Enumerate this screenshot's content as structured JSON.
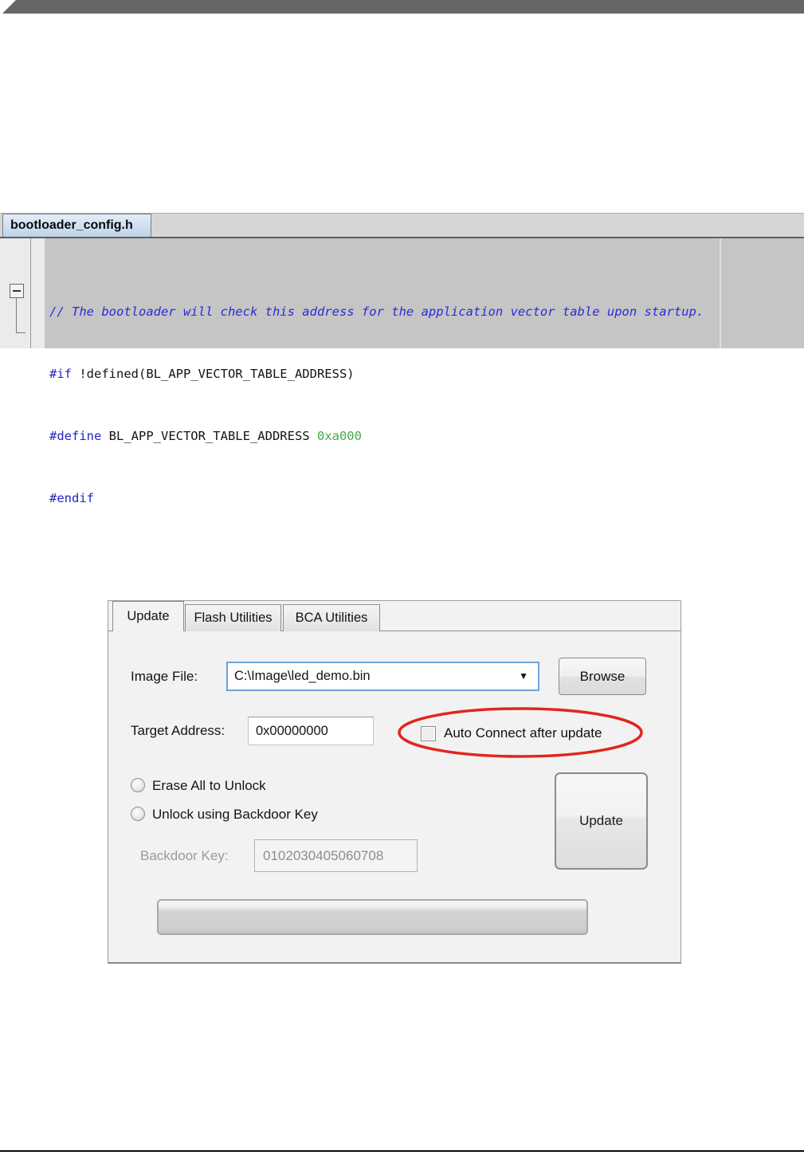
{
  "page": {
    "top_banner_color": "#666666",
    "bottom_rule_color": "#0a0a0a"
  },
  "code_editor": {
    "tab_label": "bootloader_config.h",
    "colors": {
      "background": "#c5c5c5",
      "comment": "#2a2ad8",
      "directive": "#2323c8",
      "plain": "#141414",
      "number": "#44aa44"
    },
    "lines": [
      {
        "tokens": [
          {
            "type": "comment",
            "text": "// The bootloader will check this address for the application vector table upon startup."
          }
        ]
      },
      {
        "tokens": [
          {
            "type": "directive",
            "text": "#if"
          },
          {
            "type": "plain",
            "text": " !defined(BL_APP_VECTOR_TABLE_ADDRESS)"
          }
        ]
      },
      {
        "tokens": [
          {
            "type": "directive",
            "text": "#define"
          },
          {
            "type": "plain",
            "text": " BL_APP_VECTOR_TABLE_ADDRESS "
          },
          {
            "type": "number",
            "text": "0xa000"
          }
        ]
      },
      {
        "tokens": [
          {
            "type": "directive",
            "text": "#endif"
          }
        ]
      }
    ]
  },
  "dialog": {
    "tabs": [
      {
        "label": "Update",
        "active": true
      },
      {
        "label": "Flash Utilities",
        "active": false
      },
      {
        "label": "BCA Utilities",
        "active": false
      }
    ],
    "image_file": {
      "label": "Image File:",
      "value": "C:\\Image\\led_demo.bin",
      "dropdown_icon": "▼",
      "browse_label": "Browse"
    },
    "target_address": {
      "label": "Target Address:",
      "value": "0x00000000"
    },
    "auto_connect": {
      "label": "Auto Connect after update",
      "checked": false,
      "highlight_color": "#e0271c"
    },
    "unlock_options": [
      {
        "label": "Erase All to Unlock",
        "selected": false
      },
      {
        "label": "Unlock using Backdoor Key",
        "selected": false
      }
    ],
    "backdoor_key": {
      "label": "Backdoor Key:",
      "value": "0102030405060708",
      "disabled": true
    },
    "update_button_label": "Update",
    "progress": {
      "value": 0
    }
  }
}
